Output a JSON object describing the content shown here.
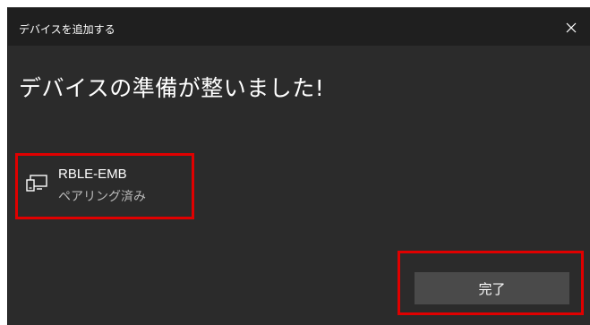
{
  "window": {
    "title": "デバイスを追加する",
    "close_icon": "close-icon"
  },
  "main": {
    "heading": "デバイスの準備が整いました!"
  },
  "device": {
    "icon": "device-icon",
    "name": "RBLE-EMB",
    "status": "ペアリング済み"
  },
  "footer": {
    "done_label": "完了"
  },
  "colors": {
    "background": "#2b2b2b",
    "titlebar": "#1f1f1f",
    "button": "#4a4a4a",
    "highlight": "#e00000"
  }
}
